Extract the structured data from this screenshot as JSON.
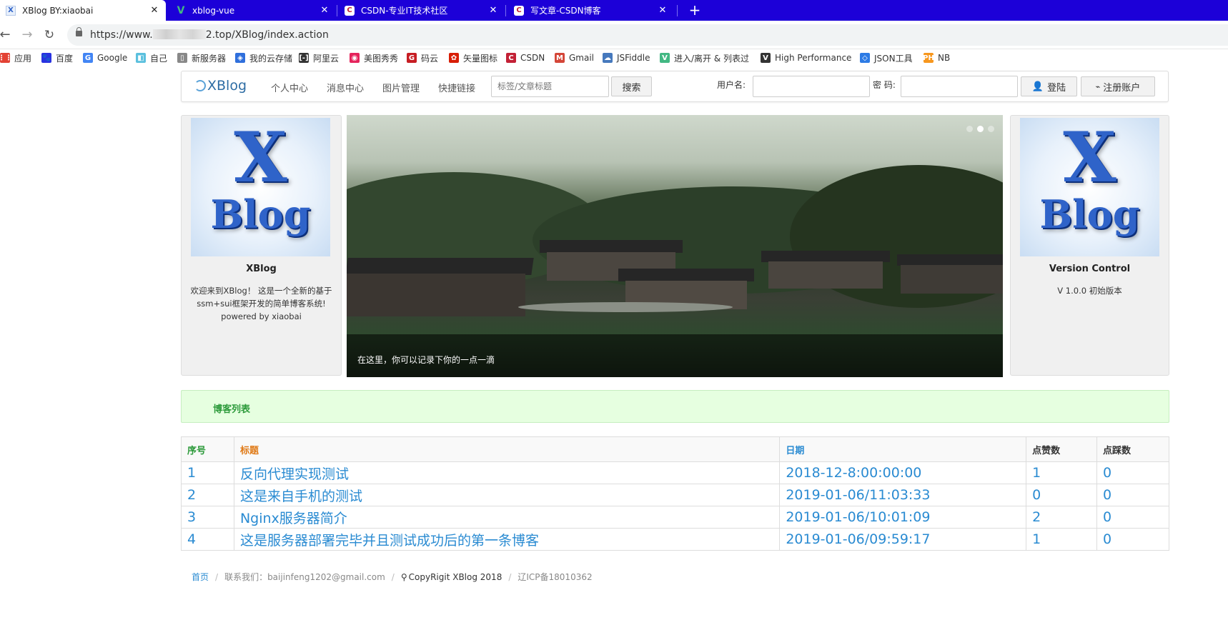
{
  "browser": {
    "tabs": [
      {
        "title": "XBlog BY:xiaobai",
        "icon": "xblog-favicon",
        "active": true
      },
      {
        "title": "xblog-vue",
        "icon": "vue-favicon",
        "active": false
      },
      {
        "title": "CSDN-专业IT技术社区",
        "icon": "csdn-favicon",
        "active": false
      },
      {
        "title": "写文章-CSDN博客",
        "icon": "csdn-favicon",
        "active": false
      }
    ],
    "close_glyph": "✕",
    "new_tab_glyph": "+",
    "url_prefix": "https://www.",
    "url_suffix": "2.top/XBlog/index.action",
    "bookmarks": [
      {
        "label": "应用",
        "color": "#e34234"
      },
      {
        "label": "百度",
        "color": "#2932e1"
      },
      {
        "label": "Google",
        "color": "#4285f4"
      },
      {
        "label": "自己",
        "color": "#5bc0de"
      },
      {
        "label": "新服务器",
        "color": "#888888"
      },
      {
        "label": "我的云存储",
        "color": "#2f6fdc"
      },
      {
        "label": "阿里云",
        "color": "#333333"
      },
      {
        "label": "美图秀秀",
        "color": "#e5245c"
      },
      {
        "label": "码云",
        "color": "#c71d23"
      },
      {
        "label": "矢量图标",
        "color": "#d81e06"
      },
      {
        "label": "CSDN",
        "color": "#c32136"
      },
      {
        "label": "Gmail",
        "color": "#d44638"
      },
      {
        "label": "JSFiddle",
        "color": "#4679bd"
      },
      {
        "label": "进入/离开 & 列表过",
        "color": "#42b883"
      },
      {
        "label": "High Performance",
        "color": "#333333"
      },
      {
        "label": "JSON工具",
        "color": "#2d7be5"
      },
      {
        "label": "NB",
        "color": "#f7971e"
      }
    ]
  },
  "navbar": {
    "brand": "XBlog",
    "menu": [
      "个人中心",
      "消息中心",
      "图片管理",
      "快捷链接"
    ],
    "search_placeholder": "标签/文章标题",
    "search_button": "搜索",
    "username_label": "用户名:",
    "password_label": "密 码:",
    "login_button": "登陆",
    "register_button": "注册账户"
  },
  "left_card": {
    "logo_x": "X",
    "logo_blog": "Blog",
    "title": "XBlog",
    "text": "欢迎来到XBlog！ 这是一个全新的基于ssm+sui框架开发的简单博客系统! powered by xiaobai"
  },
  "carousel": {
    "caption": "在这里，你可以记录下你的一点一滴",
    "slide_count": 3,
    "active_slide": 2
  },
  "right_card": {
    "logo_x": "X",
    "logo_blog": "Blog",
    "title": "Version Control",
    "text": "V 1.0.0 初始版本"
  },
  "message": {
    "text": "博客列表"
  },
  "table": {
    "headers": [
      "序号",
      "标题",
      "日期",
      "点赞数",
      "点踩数"
    ],
    "rows": [
      [
        "1",
        "反向代理实现测试",
        "2018-12-8:00:00:00",
        "1",
        "0"
      ],
      [
        "2",
        "这是来自手机的测试",
        "2019-01-06/11:03:33",
        "0",
        "0"
      ],
      [
        "3",
        "Nginx服务器简介",
        "2019-01-06/10:01:09",
        "2",
        "0"
      ],
      [
        "4",
        "这是服务器部署完毕并且测试成功后的第一条博客",
        "2019-01-06/09:59:17",
        "1",
        "0"
      ]
    ]
  },
  "footer": {
    "home": "首页",
    "separator": "/",
    "contact": "联系我们：baijinfeng1202@gmail.com",
    "copyright": "CopyRigit XBlog 2018",
    "icp": "辽ICP备18010362"
  },
  "colors": {
    "tab_bar": "#1c00d8",
    "link_blue": "#2a8bd2",
    "success_green": "#2c9a3a",
    "header_orange": "#e07a17"
  }
}
